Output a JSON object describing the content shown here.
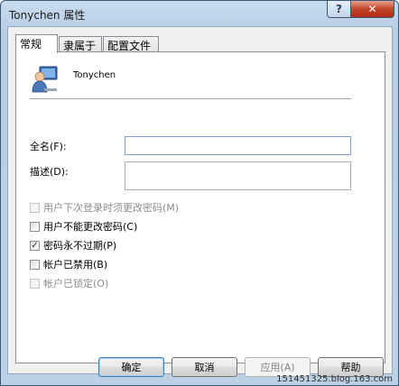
{
  "window": {
    "title": "Tonychen 属性",
    "help_label": "?",
    "close_label": "✕"
  },
  "tabs": [
    {
      "label": "常规",
      "active": true
    },
    {
      "label": "隶属于",
      "active": false
    },
    {
      "label": "配置文件",
      "active": false
    }
  ],
  "user": {
    "icon": "user-icon",
    "name": "Tonychen"
  },
  "fields": {
    "fullname": {
      "label": "全名(F):",
      "value": ""
    },
    "description": {
      "label": "描述(D):",
      "value": ""
    }
  },
  "checkboxes": [
    {
      "label": "用户下次登录时须更改密码(M)",
      "checked": false,
      "enabled": false
    },
    {
      "label": "用户不能更改密码(C)",
      "checked": false,
      "enabled": true
    },
    {
      "label": "密码永不过期(P)",
      "checked": true,
      "enabled": true
    },
    {
      "label": "帐户已禁用(B)",
      "checked": false,
      "enabled": true
    },
    {
      "label": "帐户已锁定(O)",
      "checked": false,
      "enabled": false
    }
  ],
  "buttons": {
    "ok": "确定",
    "cancel": "取消",
    "apply": "应用(A)",
    "help": "帮助"
  },
  "watermark": "151451325.blog.163.com",
  "colors": {
    "titlebar": "#c9dcef",
    "close_button": "#c6442a",
    "focus_border": "#7fa2c8"
  }
}
